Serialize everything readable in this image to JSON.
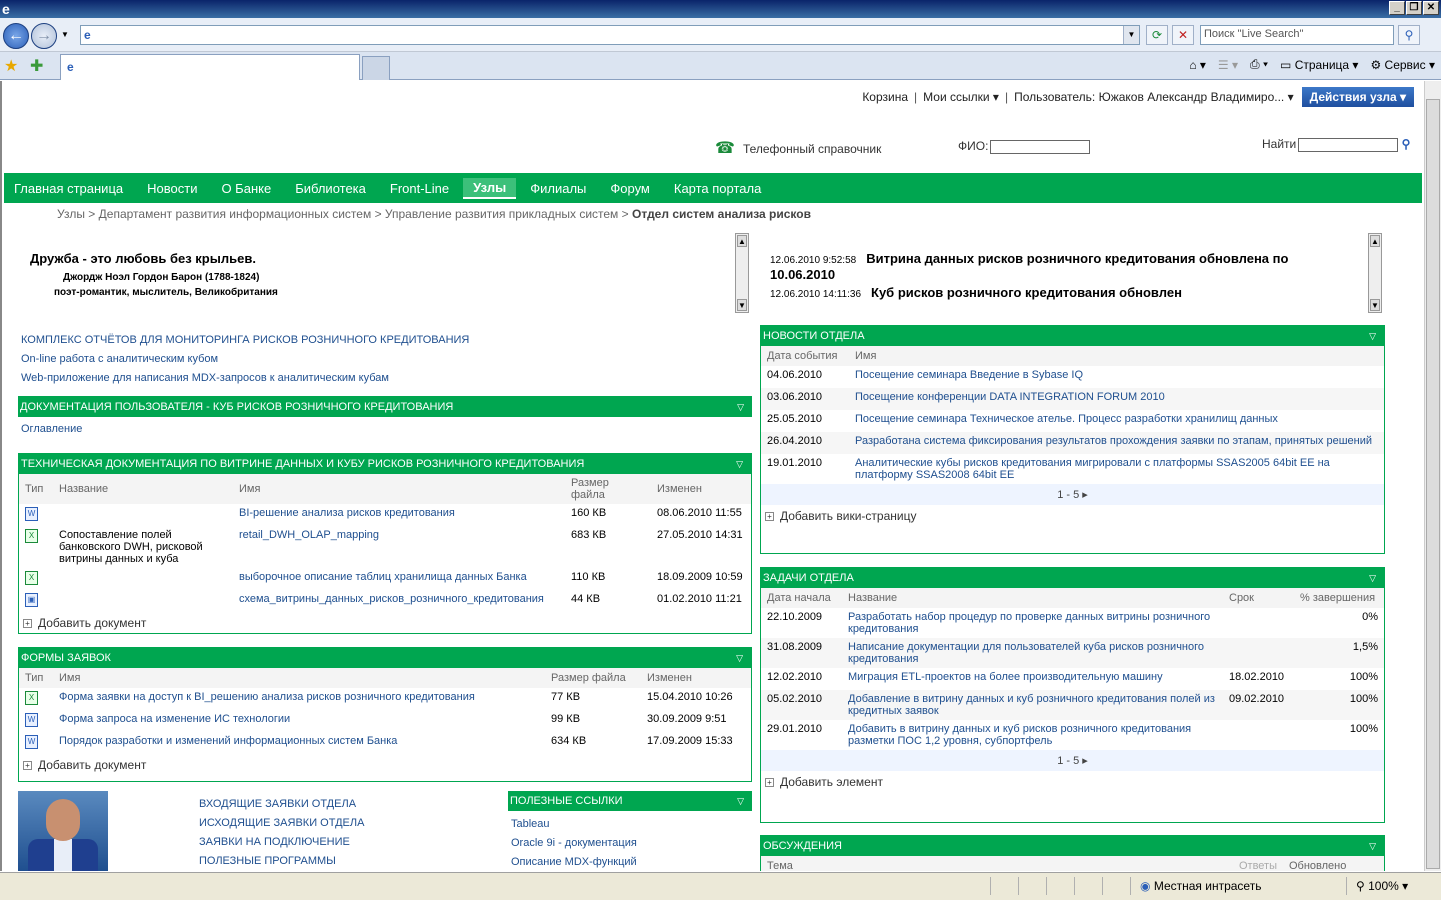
{
  "browser": {
    "search_placeholder": "Поиск \"Live Search\"",
    "cmd": {
      "page": "Страница",
      "service": "Сервис"
    },
    "status_zone": "Местная интрасеть",
    "zoom": "100%"
  },
  "header": {
    "cart": "Корзина",
    "my_links": "Мои ссылки",
    "user": "Пользователь: Южаков Александр Владимиро...",
    "actions": "Действия узла",
    "phonebook": "Телефонный справочник",
    "fio_label": "ФИО:",
    "find_label": "Найти"
  },
  "nav": [
    "Главная страница",
    "Новости",
    "О Банке",
    "Библиотека",
    "Front-Line",
    "Узлы",
    "Филиалы",
    "Форум",
    "Карта портала"
  ],
  "breadcrumb": {
    "items": [
      "Узлы",
      "Департамент развития информационных систем",
      "Управление развития прикладных систем"
    ],
    "sep": ">",
    "current": "Отдел систем анализа рисков"
  },
  "quote": {
    "text": "Дружба - это любовь без крыльев.",
    "author": "Джордж Ноэл Гордон Барон (1788-1824)",
    "desc": "поэт-романтик, мыслитель, Великобритания"
  },
  "ticker": [
    {
      "time": "12.06.2010 9:52:58",
      "text": "Витрина данных рисков розничного кредитования обновлена по",
      "text2": "10.06.2010"
    },
    {
      "time": "12.06.2010 14:11:36",
      "text": "Куб рисков розничного кредитования обновлен"
    }
  ],
  "links_top": [
    "КОМПЛЕКС ОТЧЁТОВ ДЛЯ МОНИТОРИНГА РИСКОВ РОЗНИЧНОГО КРЕДИТОВАНИЯ",
    "On-line работа с аналитическим кубом",
    "Web-приложение для написания MDX-запросов к аналитическим кубам"
  ],
  "user_docs": {
    "title": "ДОКУМЕНТАЦИЯ ПОЛЬЗОВАТЕЛЯ - КУБ РИСКОВ РОЗНИЧНОГО КРЕДИТОВАНИЯ",
    "link": "Оглавление"
  },
  "tech_docs": {
    "title": "ТЕХНИЧЕСКАЯ ДОКУМЕНТАЦИЯ ПО ВИТРИНЕ ДАННЫХ И КУБУ РИСКОВ РОЗНИЧНОГО КРЕДИТОВАНИЯ",
    "cols": [
      "Тип",
      "Название",
      "Имя",
      "Размер файла",
      "Изменен"
    ],
    "rows": [
      {
        "name": "",
        "file": "BI-решение анализа рисков кредитования",
        "size": "160 КВ",
        "mod": "08.06.2010 11:55",
        "type": "doc"
      },
      {
        "name": "Сопоставление полей банковского DWH, рисковой витрины данных и куба",
        "file": "retail_DWH_OLAP_mapping",
        "size": "683 КВ",
        "mod": "27.05.2010 14:31",
        "type": "xls"
      },
      {
        "name": "",
        "file": "выборочное описание таблиц хранилища данных Банка",
        "size": "110 КВ",
        "mod": "18.09.2009 10:59",
        "type": "xls"
      },
      {
        "name": "",
        "file": "схема_витрины_данных_рисков_розничного_кредитования",
        "size": "44 КВ",
        "mod": "01.02.2010 11:21",
        "type": "img"
      }
    ],
    "add": "Добавить документ"
  },
  "forms": {
    "title": "ФОРМЫ ЗАЯВОК",
    "cols": [
      "Тип",
      "Имя",
      "Размер файла",
      "Изменен"
    ],
    "rows": [
      {
        "file": "Форма заявки на доступ к BI_решению анализа рисков розничного кредитования",
        "size": "77 КВ",
        "mod": "15.04.2010 10:26",
        "type": "xls"
      },
      {
        "file": "Форма запроса на изменение ИС технологии",
        "size": "99 КВ",
        "mod": "30.09.2009 9:51",
        "type": "doc"
      },
      {
        "file": "Порядок разработки и изменений информационных систем Банка",
        "size": "634 КВ",
        "mod": "17.09.2009 15:33",
        "type": "doc"
      }
    ],
    "add": "Добавить документ"
  },
  "bottom_links": [
    "ВХОДЯЩИЕ ЗАЯВКИ ОТДЕЛА",
    "ИСХОДЯЩИЕ ЗАЯВКИ ОТДЕЛА",
    "ЗАЯВКИ НА ПОДКЛЮЧЕНИЕ",
    "ПОЛЕЗНЫЕ ПРОГРАММЫ"
  ],
  "useful": {
    "title": "ПОЛЕЗНЫЕ ССЫЛКИ",
    "links": [
      "Tableau",
      "Oracle 9i - документация",
      "Описание MDX-функций"
    ]
  },
  "dept_news": {
    "title": "НОВОСТИ ОТДЕЛА",
    "cols": [
      "Дата события",
      "Имя"
    ],
    "rows": [
      {
        "date": "04.06.2010",
        "name": "Посещение семинара Введение в Sybase IQ"
      },
      {
        "date": "03.06.2010",
        "name": "Посещение конференции DATA INTEGRATION FORUM 2010"
      },
      {
        "date": "25.05.2010",
        "name": "Посещение семинара Техническое ателье. Процесс разработки хранилищ данных"
      },
      {
        "date": "26.04.2010",
        "name": "Разработана система фиксирования результатов прохождения заявки по этапам, принятых решений"
      },
      {
        "date": "19.01.2010",
        "name": "Аналитические кубы рисков кредитования мигрировали с платформы SSAS2005 64bit EE на платформу SSAS2008 64bit EE"
      }
    ],
    "pager": "1 - 5",
    "add": "Добавить вики-страницу"
  },
  "tasks": {
    "title": "ЗАДАЧИ ОТДЕЛА",
    "cols": [
      "Дата начала",
      "Название",
      "Срок",
      "% завершения"
    ],
    "rows": [
      {
        "start": "22.10.2009",
        "name": "Разработать набор процедур по проверке данных витрины розничного кредитования",
        "due": "",
        "pct": "0%"
      },
      {
        "start": "31.08.2009",
        "name": "Написание документации для пользователей куба рисков розничного кредитования",
        "due": "",
        "pct": "1,5%"
      },
      {
        "start": "12.02.2010",
        "name": "Миграция ETL-проектов на более производительную машину",
        "due": "18.02.2010",
        "pct": "100%"
      },
      {
        "start": "05.02.2010",
        "name": "Добавление в витрину данных и куб розничного кредитования полей из кредитных заявок",
        "due": "09.02.2010",
        "pct": "100%"
      },
      {
        "start": "29.01.2010",
        "name": "Добавить в витрину данных и куб рисков розничного кредитования разметки ПОС 1,2 уровня, субпортфель",
        "due": "",
        "pct": "100%"
      }
    ],
    "pager": "1 - 5",
    "add": "Добавить элемент"
  },
  "discussions": {
    "title": "ОБСУЖДЕНИЯ",
    "cols": [
      "Тема",
      "Ответы",
      "Обновлено"
    ]
  }
}
